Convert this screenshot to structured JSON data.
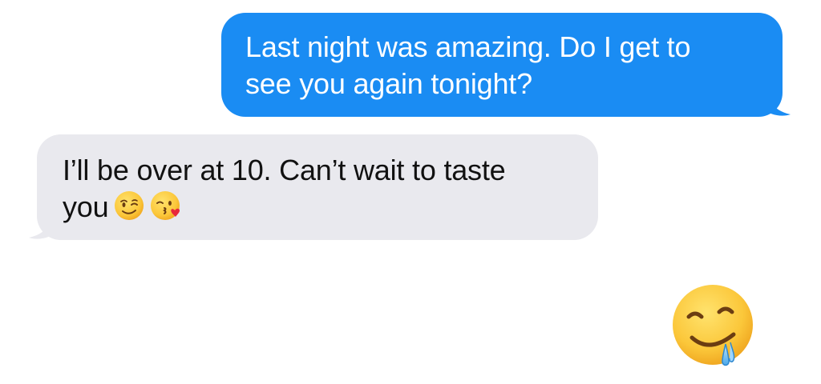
{
  "conversation": {
    "messages": [
      {
        "direction": "sent",
        "line1": "Last night was amazing. Do I get to",
        "line2": "see you again tonight?",
        "bubble_color": "#1a8cf3"
      },
      {
        "direction": "received",
        "line1": "I’ll be over at 10. Can’t wait to taste",
        "line2": "you",
        "emojis": [
          "winking-face-emoji",
          "face-blowing-kiss-emoji"
        ],
        "bubble_color": "#e9e9ee"
      },
      {
        "direction": "sent",
        "type": "emoji-only",
        "emoji": "drooling-face-emoji"
      }
    ]
  }
}
